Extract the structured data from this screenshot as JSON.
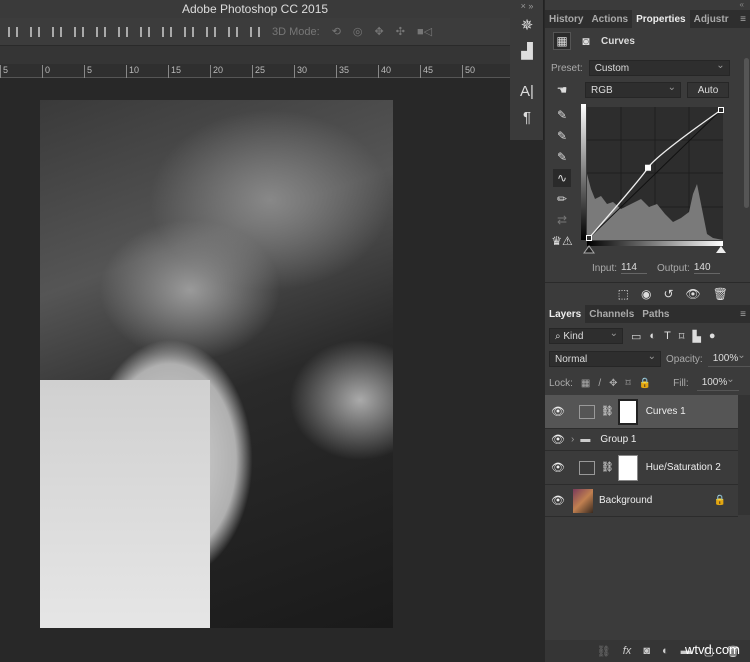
{
  "app": {
    "title": "Adobe Photoshop CC 2015"
  },
  "options_bar": {
    "mode_label": "3D Mode:"
  },
  "ruler": {
    "ticks": [
      "5",
      "0",
      "5",
      "10",
      "15",
      "20",
      "25",
      "30",
      "35",
      "40",
      "45",
      "50"
    ]
  },
  "properties": {
    "tabs": [
      "History",
      "Actions",
      "Properties",
      "Adjustr"
    ],
    "active_tab": "Properties",
    "title": "Curves",
    "preset_label": "Preset:",
    "preset_value": "Custom",
    "channel_value": "RGB",
    "auto_label": "Auto",
    "input_label": "Input:",
    "input_value": "114",
    "output_label": "Output:",
    "output_value": "140",
    "curve_points": [
      [
        0,
        0
      ],
      [
        114,
        140
      ],
      [
        255,
        255
      ]
    ]
  },
  "layers": {
    "tabs": [
      "Layers",
      "Channels",
      "Paths"
    ],
    "filter_value": "Kind",
    "blend_mode": "Normal",
    "opacity_label": "Opacity:",
    "opacity_value": "100%",
    "lock_label": "Lock:",
    "fill_label": "Fill:",
    "fill_value": "100%",
    "items": [
      {
        "name": "Curves 1",
        "type": "curves",
        "selected": true
      },
      {
        "name": "Group 1",
        "type": "group"
      },
      {
        "name": "Hue/Saturation 2",
        "type": "huesat"
      },
      {
        "name": "Background",
        "type": "image",
        "locked": true
      }
    ]
  },
  "watermark": "wtvd.com"
}
